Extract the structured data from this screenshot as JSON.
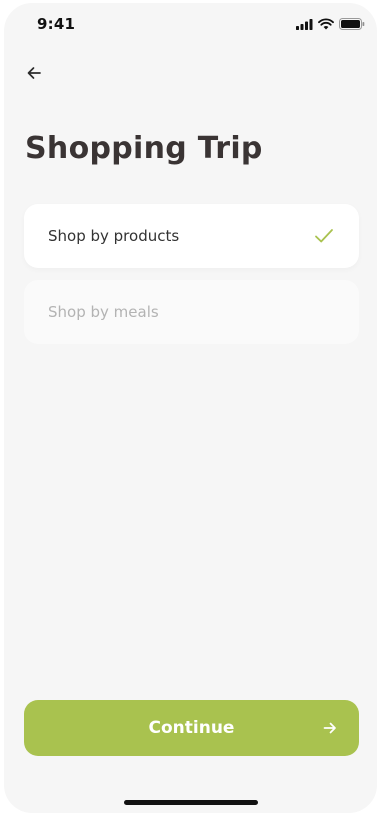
{
  "status_bar": {
    "time": "9:41",
    "icons": [
      "cellular-signal-icon",
      "wifi-icon",
      "battery-icon"
    ]
  },
  "header": {
    "back_icon": "arrow-left-icon",
    "title": "Shopping Trip"
  },
  "options": [
    {
      "label": "Shop by products",
      "selected": true,
      "icon": "checkmark-icon"
    },
    {
      "label": "Shop by meals",
      "selected": false
    }
  ],
  "footer": {
    "continue_label": "Continue",
    "continue_icon": "arrow-right-icon"
  },
  "colors": {
    "accent": "#a9c24f",
    "background": "#f6f6f6",
    "title": "#3a3434",
    "muted": "#b3b3b3"
  }
}
